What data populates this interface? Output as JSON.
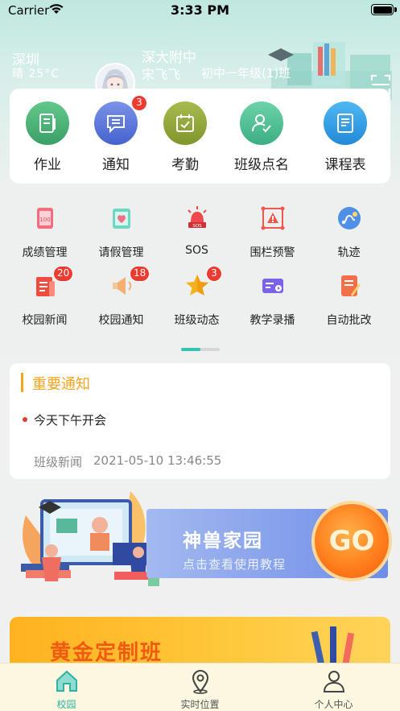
{
  "status_bar": {
    "carrier": "Carrier",
    "time": "3:33 PM"
  },
  "header": {
    "city": "深圳",
    "weather": "晴  25°C",
    "school": "深大附中",
    "student": "宋飞飞",
    "class": "初中一年级(1)班"
  },
  "main_menu": [
    {
      "label": "作业",
      "icon": "homework-icon",
      "color": "#3fae6e"
    },
    {
      "label": "通知",
      "icon": "notification-icon",
      "color": "#4d6fd8",
      "badge": "3"
    },
    {
      "label": "考勤",
      "icon": "attendance-icon",
      "color": "#8ea33a"
    },
    {
      "label": "班级点名",
      "icon": "roll-call-icon",
      "color": "#4dbf93"
    },
    {
      "label": "课程表",
      "icon": "schedule-icon",
      "color": "#2fa3e6"
    }
  ],
  "grid_menu": [
    {
      "label": "成绩管理",
      "icon": "grades-icon"
    },
    {
      "label": "请假管理",
      "icon": "leave-icon"
    },
    {
      "label": "SOS",
      "icon": "sos-siren-icon"
    },
    {
      "label": "围栏预警",
      "icon": "fence-alert-icon"
    },
    {
      "label": "轨迹",
      "icon": "track-icon"
    },
    {
      "label": "校园新闻",
      "icon": "campus-news-icon",
      "badge": "20"
    },
    {
      "label": "校园通知",
      "icon": "campus-notice-icon",
      "badge": "18"
    },
    {
      "label": "班级动态",
      "icon": "class-feed-icon",
      "badge": "3"
    },
    {
      "label": "教学录播",
      "icon": "lecture-video-icon"
    },
    {
      "label": "自动批改",
      "icon": "auto-grading-icon"
    }
  ],
  "notice": {
    "title": "重要通知",
    "item": "今天下午开会",
    "source": "班级新闻",
    "time": "2021-05-10 13:46:55"
  },
  "banner_tutorial": {
    "title": "神兽家园",
    "subtitle": "点击查看使用教程",
    "button": "GO"
  },
  "banner_gold": {
    "title": "黄金定制班"
  },
  "tabbar": [
    {
      "label": "校园",
      "icon": "home-icon",
      "active": true
    },
    {
      "label": "实时位置",
      "icon": "location-pin-icon",
      "active": false
    },
    {
      "label": "个人中心",
      "icon": "profile-icon",
      "active": false
    }
  ],
  "colors": {
    "accent": "#35c2b0",
    "notice_orange": "#f5a41e",
    "badge_red": "#ee3b2f"
  }
}
